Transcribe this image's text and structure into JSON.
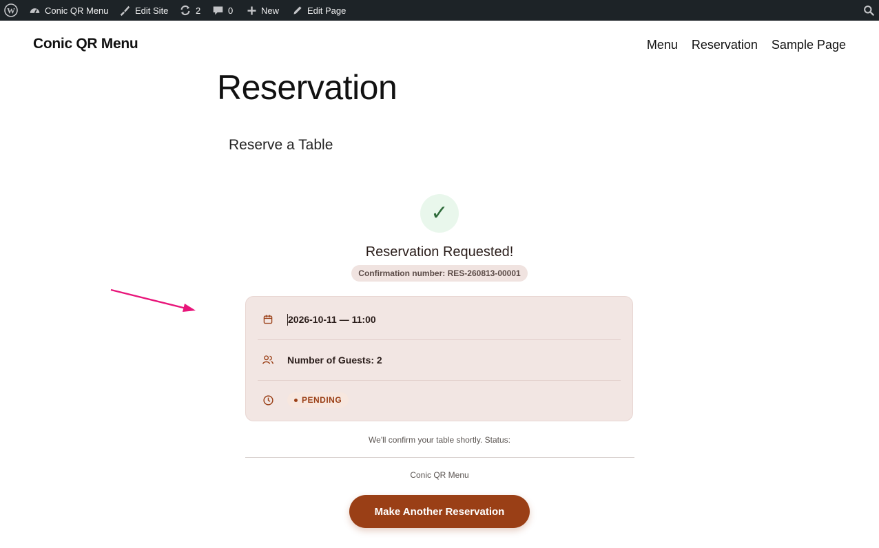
{
  "admin_bar": {
    "site_name": "Conic QR Menu",
    "edit_site": "Edit Site",
    "updates_count": "2",
    "comments_count": "0",
    "new_label": "New",
    "edit_page": "Edit Page"
  },
  "header": {
    "site_title": "Conic QR Menu",
    "nav": [
      "Menu",
      "Reservation",
      "Sample Page"
    ]
  },
  "page": {
    "title": "Reservation",
    "section_title": "Reserve a Table"
  },
  "confirmation": {
    "check_glyph": "✓",
    "title": "Reservation Requested!",
    "number_label": "Confirmation number: ",
    "number_value": "RES-260813-00001"
  },
  "details": {
    "datetime": "2026-10-11 — 11:00",
    "guests": "Number of Guests: 2",
    "status": "PENDING"
  },
  "footer": {
    "note": "We'll confirm your table shortly. Status:",
    "brand": "Conic QR Menu",
    "cta": "Make Another Reservation"
  },
  "colors": {
    "admin_bar": "#1d2327",
    "accent": "#9a3f16",
    "card_bg": "#f2e6e3",
    "success_bg": "#e9f7ec",
    "success_check": "#2e6b3a",
    "annotation_arrow": "#e8157a"
  }
}
